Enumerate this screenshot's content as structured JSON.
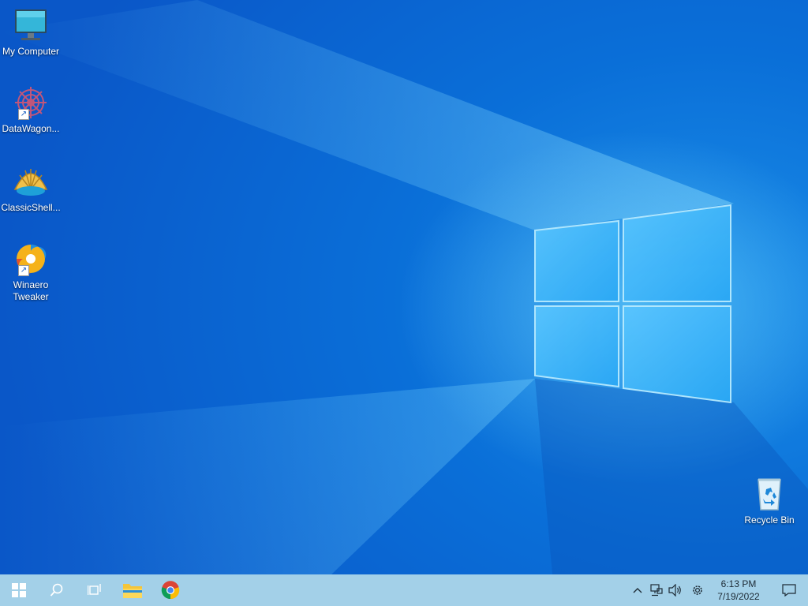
{
  "desktop": {
    "icons": [
      {
        "label": "My Computer",
        "icon": "monitor-icon"
      },
      {
        "label": "DataWagon...",
        "icon": "datawagon-icon",
        "shortcut": true
      },
      {
        "label": "ClassicShell...",
        "icon": "classic-shell-icon"
      },
      {
        "label": "Winaero Tweaker",
        "icon": "winaero-tweaker-icon",
        "shortcut": true
      },
      {
        "label": "Recycle Bin",
        "icon": "recycle-bin-icon"
      }
    ],
    "shortcut_arrow": "↗"
  },
  "taskbar": {
    "pinned": [
      {
        "name": "start-button",
        "icon": "windows-logo-icon"
      },
      {
        "name": "search-button",
        "icon": "search-icon"
      },
      {
        "name": "task-view-button",
        "icon": "task-view-icon"
      },
      {
        "name": "file-explorer-button",
        "icon": "folder-icon"
      },
      {
        "name": "chrome-button",
        "icon": "chrome-icon"
      }
    ],
    "tray": {
      "chevron": "^",
      "time": "6:13 PM",
      "date": "7/19/2022"
    },
    "colors": {
      "taskbar_bg": "#a3d0e8",
      "desktop_blue": "#0a6fd8"
    }
  }
}
